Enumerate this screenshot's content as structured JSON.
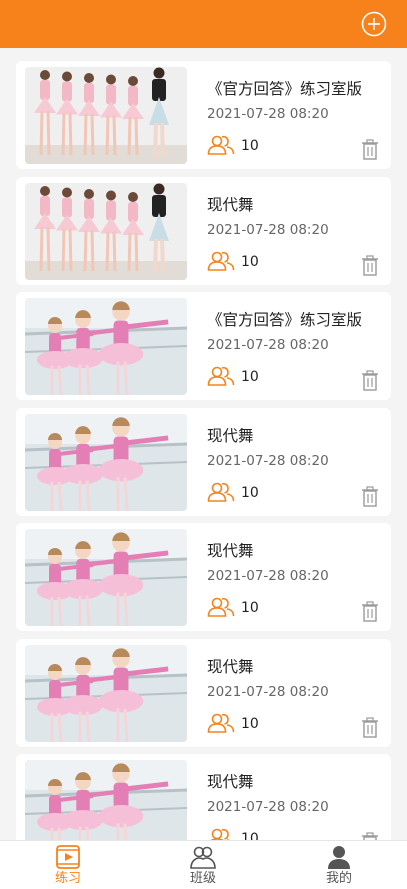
{
  "header": {
    "add_icon": "plus-circle-icon",
    "bg_color": "#f7821b"
  },
  "items": [
    {
      "title": "《官方回答》练习室版",
      "date": "2021-07-28 08:20",
      "count": "10",
      "thumb": "pink"
    },
    {
      "title": "现代舞",
      "date": "2021-07-28 08:20",
      "count": "10",
      "thumb": "pink"
    },
    {
      "title": "《官方回答》练习室版",
      "date": "2021-07-28 08:20",
      "count": "10",
      "thumb": "barre"
    },
    {
      "title": "现代舞",
      "date": "2021-07-28 08:20",
      "count": "10",
      "thumb": "barre"
    },
    {
      "title": "现代舞",
      "date": "2021-07-28 08:20",
      "count": "10",
      "thumb": "barre"
    },
    {
      "title": "现代舞",
      "date": "2021-07-28 08:20",
      "count": "10",
      "thumb": "barre"
    },
    {
      "title": "现代舞",
      "date": "2021-07-28 08:20",
      "count": "10",
      "thumb": "barre"
    }
  ],
  "tabbar": {
    "tabs": [
      {
        "label": "练习",
        "icon": "play-video-icon",
        "active": true
      },
      {
        "label": "班级",
        "icon": "group-icon",
        "active": false
      },
      {
        "label": "我的",
        "icon": "person-icon",
        "active": false
      }
    ],
    "active_color": "#f7821b",
    "inactive_color": "#555555"
  }
}
